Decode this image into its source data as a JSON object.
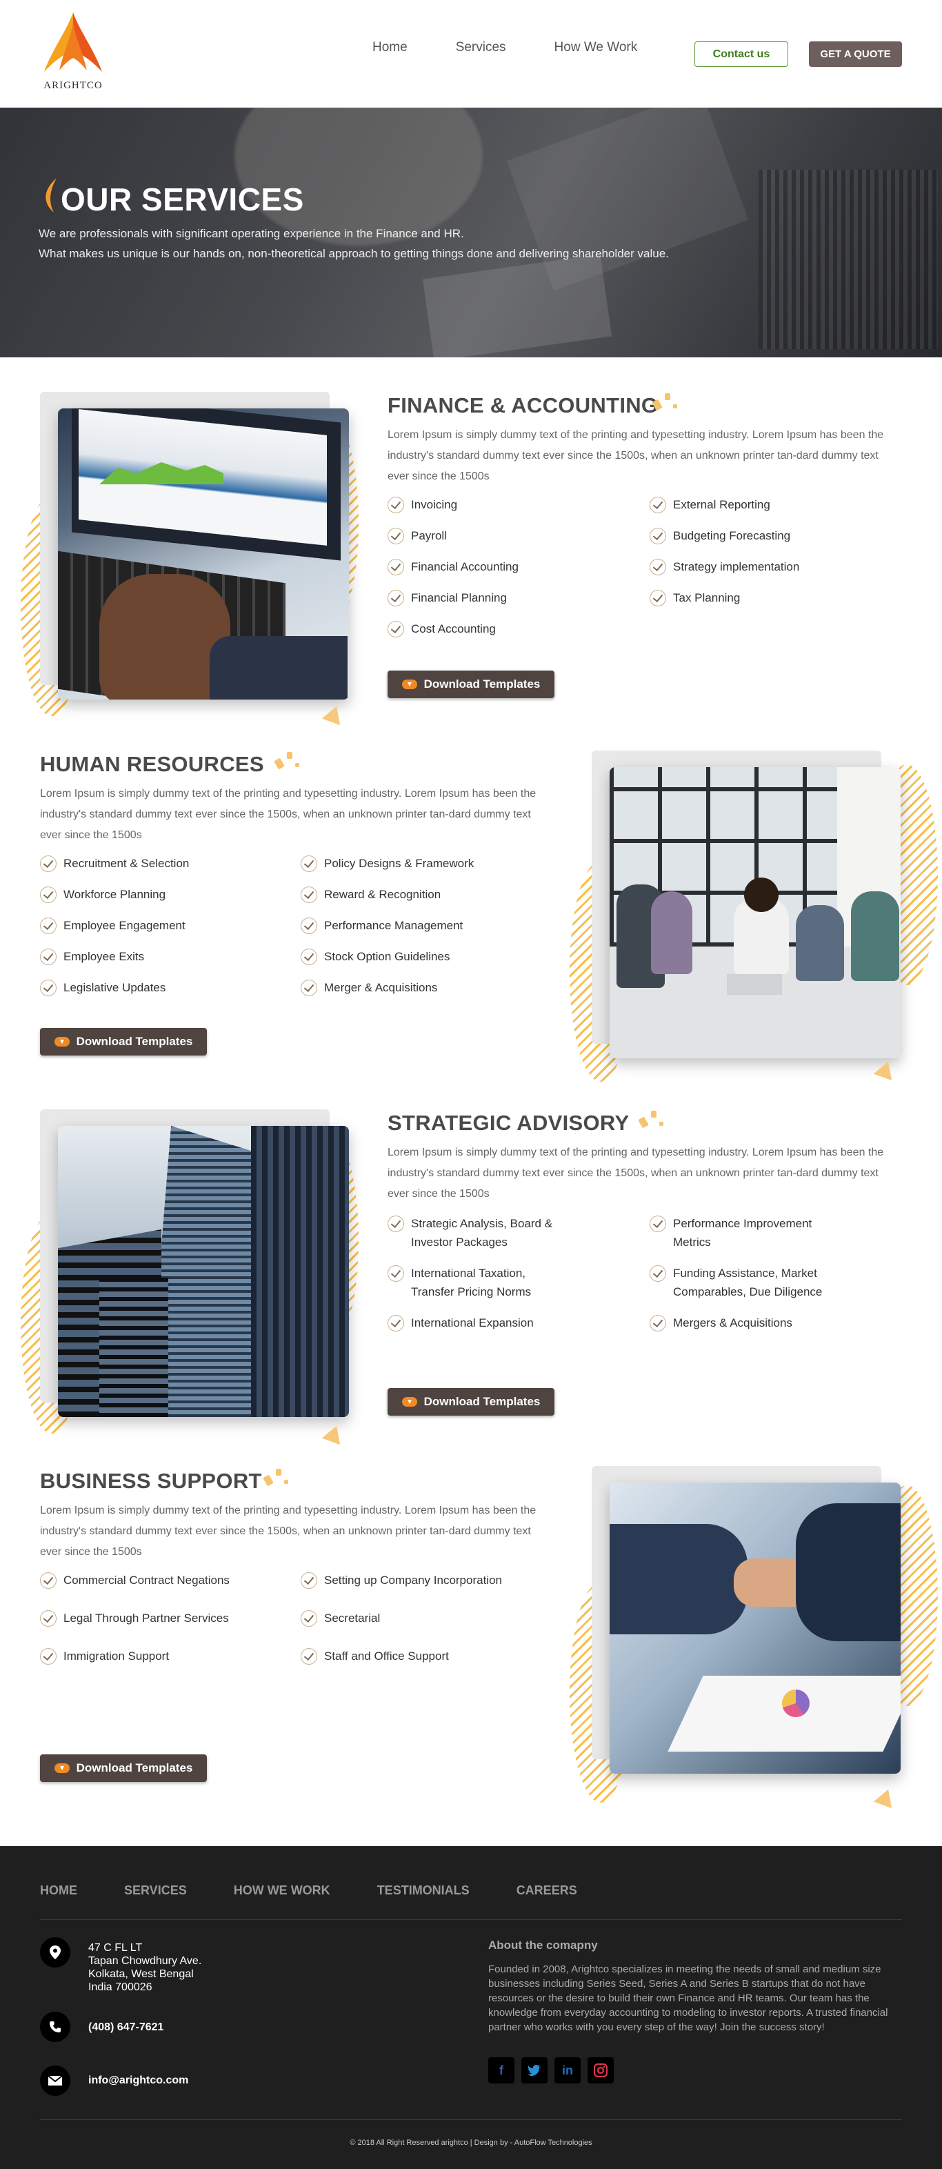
{
  "brand": {
    "logo_text": "ARIGHTCO"
  },
  "nav": {
    "items": [
      "Home",
      "Services",
      "How We Work"
    ],
    "contact_label": "Contact us",
    "quote_label": "GET A QUOTE"
  },
  "hero": {
    "title": "OUR SERVICES",
    "line1": "We are professionals with significant operating experience in the Finance and HR.",
    "line2": "What makes us unique is our hands on, non-theoretical approach to getting things done and delivering  shareholder value."
  },
  "lorem": "Lorem Ipsum is simply dummy text of the printing and typesetting industry. Lorem Ipsum has been the industry's standard dummy text ever since the 1500s, when an unknown printer tan-dard dummy text ever since the 1500s",
  "download_label": "Download Templates",
  "finance": {
    "title": "FINANCE & ACCOUNTING",
    "items": [
      "Invoicing",
      "External Reporting",
      "Payroll",
      "Budgeting Forecasting",
      "Financial Accounting",
      "Strategy implementation",
      "Financial Planning",
      "Tax Planning",
      "Cost Accounting"
    ]
  },
  "hr": {
    "title": "HUMAN RESOURCES",
    "items": [
      "Recruitment & Selection",
      "Policy Designs & Framework",
      "Workforce Planning",
      "Reward & Recognition",
      "Employee Engagement",
      "Performance Management",
      "Employee Exits",
      "Stock Option Guidelines",
      "Legislative Updates",
      "Merger & Acquisitions"
    ]
  },
  "strategic": {
    "title": "STRATEGIC ADVISORY",
    "items": [
      "Strategic Analysis, Board & Investor Packages",
      "Performance Improvement Metrics",
      "International Taxation, Transfer Pricing Norms",
      "Funding Assistance, Market Comparables, Due Diligence",
      "International Expansion",
      "Mergers & Acquisitions"
    ]
  },
  "business": {
    "title": "BUSINESS SUPPORT",
    "items": [
      "Commercial Contract Negations",
      "Setting up Company Incorporation",
      "Legal Through Partner Services",
      "Secretarial",
      "Immigration Support",
      "Staff and Office Support"
    ]
  },
  "footer": {
    "nav": [
      "HOME",
      "SERVICES",
      "HOW WE WORK",
      "TESTIMONIALS",
      "CAREERS"
    ],
    "address": [
      "47 C FL LT",
      "Tapan Chowdhury Ave.",
      "Kolkata, West Bengal",
      "India 700026"
    ],
    "phone": "(408) 647-7621",
    "email": "info@arightco.com",
    "about_heading": "About the comapny",
    "about_text": "Founded in 2008, Arightco specializes in meeting the needs of small and medium size businesses including Series Seed, Series A and Series B startups that do not have resources or the desire to build their own Finance and HR teams. Our team has the knowledge from everyday accounting to modeling to investor reports. A trusted financial partner who works with you every step of the way! Join the success story!",
    "social": [
      "f",
      "t",
      "in",
      "ig"
    ],
    "copyright": "© 2018 All Right Reserved arightco | Design by - AutoFlow Technologies"
  },
  "colors": {
    "accent": "#f08a24",
    "dark_button": "#504440",
    "footer_bg": "#1f1f1f"
  }
}
